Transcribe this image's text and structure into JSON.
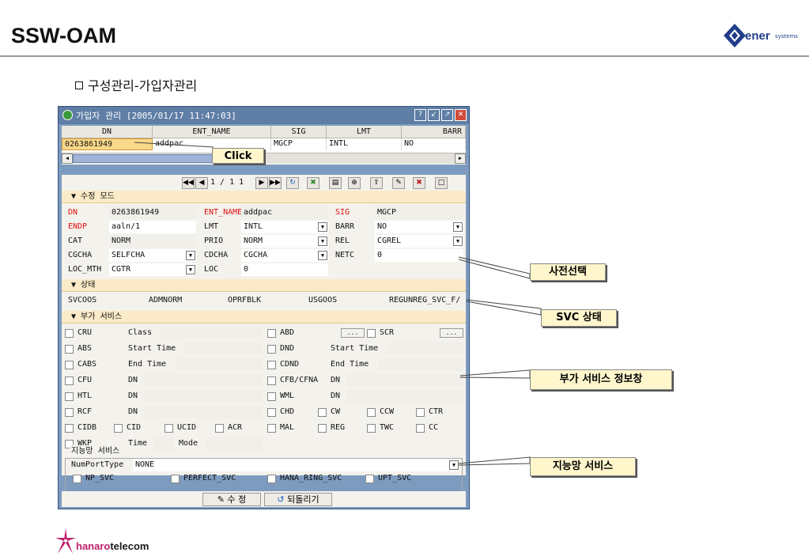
{
  "slide": {
    "title": "SSW-OAM",
    "subtitle": "구성관리-가입자관리",
    "logo_top": "ener",
    "logo_small": "systems",
    "logo_bottom_a": "hanaro",
    "logo_bottom_b": "telecom"
  },
  "window": {
    "title": "가입자 관리 [2005/01/17 11:47:03]",
    "grid_headers": [
      "DN",
      "ENT_NAME",
      "SIG",
      "LMT",
      "BARR"
    ],
    "grid_row": {
      "dn": "0263861949",
      "ent": "addpac",
      "sig": "MGCP",
      "lmt": "INTL",
      "barr": "NO"
    },
    "pager": "1 / 1   1",
    "sections": {
      "edit": "▼ 수정 모드",
      "status": "▼ 상태",
      "extra": "▼ 부가 서비스"
    },
    "edit": {
      "dn_l": "DN",
      "dn_v": "0263861949",
      "ent_l": "ENT_NAME",
      "ent_v": "addpac",
      "sig_l": "SIG",
      "sig_v": "MGCP",
      "endp_l": "ENDP",
      "endp_v": "aaln/1",
      "lmt_l": "LMT",
      "lmt_v": "INTL",
      "barr_l": "BARR",
      "barr_v": "NO",
      "cat_l": "CAT",
      "cat_v": "NORM",
      "prio_l": "PRIO",
      "prio_v": "NORM",
      "rel_l": "REL",
      "rel_v": "CGREL",
      "cgcha_l": "CGCHA",
      "cgcha_v": "SELFCHA",
      "cdcha_l": "CDCHA",
      "cdcha_v": "CGCHA",
      "netc_l": "NETC",
      "netc_v": "0",
      "loc_mth_l": "LOC_MTH",
      "loc_mth_v": "CGTR",
      "loc_l": "LOC",
      "loc_v": "0"
    },
    "status": [
      "SVCOOS",
      "ADMNORM",
      "OPRFBLK",
      "USGOOS",
      "REGUNREG_SVC_F/"
    ],
    "extra": {
      "cru": "CRU",
      "class": "Class",
      "abd": "ABD",
      "scr": "SCR",
      "dots": "...",
      "abs": "ABS",
      "start_time": "Start Time",
      "dnd": "DND",
      "start_time2": "Start Time",
      "cabs": "CABS",
      "end_time": "End Time",
      "cdnd": "CDND",
      "end_time2": "End Time",
      "cfu": "CFU",
      "dn1": "DN",
      "cfb": "CFB/CFNA",
      "dn2": "DN",
      "htl": "HTL",
      "dn3": "DN",
      "wml": "WML",
      "dn4": "DN",
      "rcf": "RCF",
      "dn5": "DN",
      "chd": "CHD",
      "cw": "CW",
      "ccw": "CCW",
      "ctr": "CTR",
      "cidb": "CIDB",
      "cid": "CID",
      "ucid": "UCID",
      "acr": "ACR",
      "mal": "MAL",
      "reg": "REG",
      "twc": "TWC",
      "cc": "CC",
      "wkp": "WKP",
      "time": "Time",
      "mode": "Mode"
    },
    "intelligent": {
      "legend": "지능망 서비스",
      "numport_l": "NumPortType",
      "numport_v": "NONE",
      "np": "NP_SVC",
      "perfect": "PERFECT_SVC",
      "hana": "HANA_RING_SVC",
      "upt": "UPT_SVC"
    },
    "buttons": {
      "modify": "수 정",
      "back": "되돌리기"
    }
  },
  "callouts": {
    "click": "Click",
    "dict": "사전선택",
    "svc": "SVC 상태",
    "extra_info": "부가 서비스 정보창",
    "intel": "지능망 서비스"
  }
}
